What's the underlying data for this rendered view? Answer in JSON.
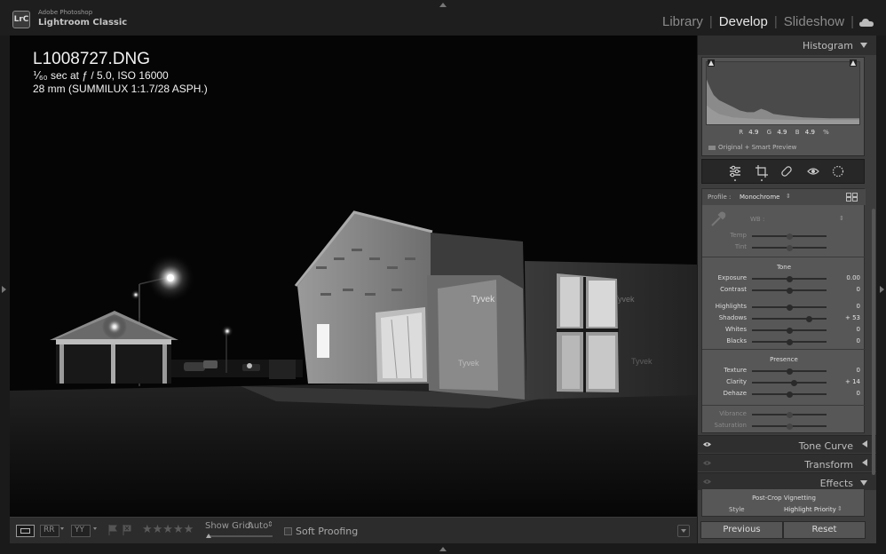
{
  "app": {
    "logo": "LrC",
    "vendor": "Adobe Photoshop",
    "name": "Lightroom Classic"
  },
  "modules": {
    "items": [
      "Library",
      "Develop",
      "Slideshow"
    ],
    "active": "Develop",
    "cloud_icon": "cloud-icon"
  },
  "overlay": {
    "filename": "L1008727.DNG",
    "exposure_line": "⅟₆₀ sec at ƒ / 5.0, ISO 16000",
    "lens_line": "28 mm (SUMMILUX 1:1.7/28 ASPH.)"
  },
  "toolbar": {
    "show_grid_label": "Show Grid:",
    "show_grid_value": "Auto",
    "soft_proofing_label": "Soft Proofing",
    "stars": "★★★★★"
  },
  "histogram": {
    "title": "Histogram",
    "r_label": "R",
    "r_value": "4.9",
    "g_label": "G",
    "g_value": "4.9",
    "b_label": "B",
    "b_value": "4.9",
    "unit": "%",
    "preview_label": "Original + Smart Preview"
  },
  "basic": {
    "profile_label": "Profile :",
    "profile_value": "Monochrome",
    "wb_label": "WB :",
    "temp_label": "Temp",
    "tint_label": "Tint",
    "tone_title": "Tone",
    "presence_title": "Presence",
    "sliders": {
      "exposure": {
        "label": "Exposure",
        "value": "0.00",
        "pos": 0.5
      },
      "contrast": {
        "label": "Contrast",
        "value": "0",
        "pos": 0.5
      },
      "highlights": {
        "label": "Highlights",
        "value": "0",
        "pos": 0.5
      },
      "shadows": {
        "label": "Shadows",
        "value": "+ 53",
        "pos": 0.765
      },
      "whites": {
        "label": "Whites",
        "value": "0",
        "pos": 0.5
      },
      "blacks": {
        "label": "Blacks",
        "value": "0",
        "pos": 0.5
      },
      "texture": {
        "label": "Texture",
        "value": "0",
        "pos": 0.5
      },
      "clarity": {
        "label": "Clarity",
        "value": "+ 14",
        "pos": 0.57
      },
      "dehaze": {
        "label": "Dehaze",
        "value": "0",
        "pos": 0.5
      },
      "vibrance": {
        "label": "Vibrance",
        "value": "",
        "pos": 0.5
      },
      "saturation": {
        "label": "Saturation",
        "value": "",
        "pos": 0.5
      },
      "temp": {
        "pos": 0.5
      },
      "tint": {
        "pos": 0.5
      }
    }
  },
  "panels": {
    "tone_curve": "Tone Curve",
    "transform": "Transform",
    "effects": "Effects",
    "post_crop": "Post-Crop Vignetting",
    "style_label": "Style",
    "style_value": "Highlight Priority"
  },
  "buttons": {
    "previous": "Previous",
    "reset": "Reset"
  },
  "colors": {
    "background": "#1a1a1a",
    "panel": "#3d3d3d",
    "active_module": "#e8e8e8"
  }
}
